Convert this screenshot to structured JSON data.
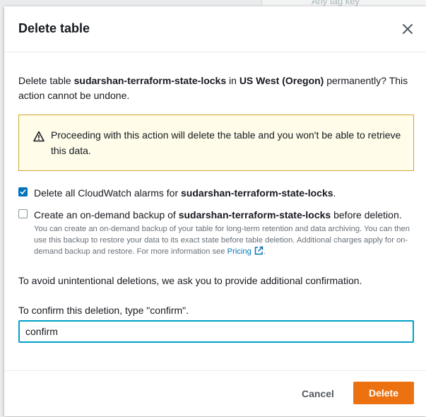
{
  "background": {
    "tag_placeholder": "Any tag key"
  },
  "modal": {
    "title": "Delete table",
    "intro": {
      "prefix": "Delete table ",
      "table_name": "sudarshan-terraform-state-locks",
      "middle": " in ",
      "region": "US West (Oregon)",
      "suffix": " permanently? This action cannot be undone."
    },
    "warning": {
      "icon": "warning-triangle-icon",
      "text": "Proceeding with this action will delete the table and you won't be able to retrieve this data."
    },
    "alarms_option": {
      "checked": true,
      "prefix": "Delete all CloudWatch alarms for ",
      "table_name": "sudarshan-terraform-state-locks",
      "suffix": "."
    },
    "backup_option": {
      "checked": false,
      "prefix": "Create an on-demand backup of ",
      "table_name": "sudarshan-terraform-state-locks",
      "suffix": " before deletion.",
      "description": "You can create an on-demand backup of your table for long-term retention and data archiving. You can then use this backup to restore your data to its exact state before table deletion. Additional charges apply for on-demand backup and restore. For more information see ",
      "link_text": "Pricing",
      "link_suffix": "."
    },
    "confirmation_note": "To avoid unintentional deletions, we ask you to provide additional confirmation.",
    "confirm_label": "To confirm this deletion, type \"confirm\".",
    "confirm_value": "confirm",
    "cancel_label": "Cancel",
    "delete_label": "Delete"
  },
  "colors": {
    "primary_button": "#ec7211",
    "checkbox_checked": "#0073bb",
    "warning_border": "#d0a533",
    "warning_background": "#fffce9",
    "input_focus": "#00a1c9",
    "link": "#0073bb"
  }
}
